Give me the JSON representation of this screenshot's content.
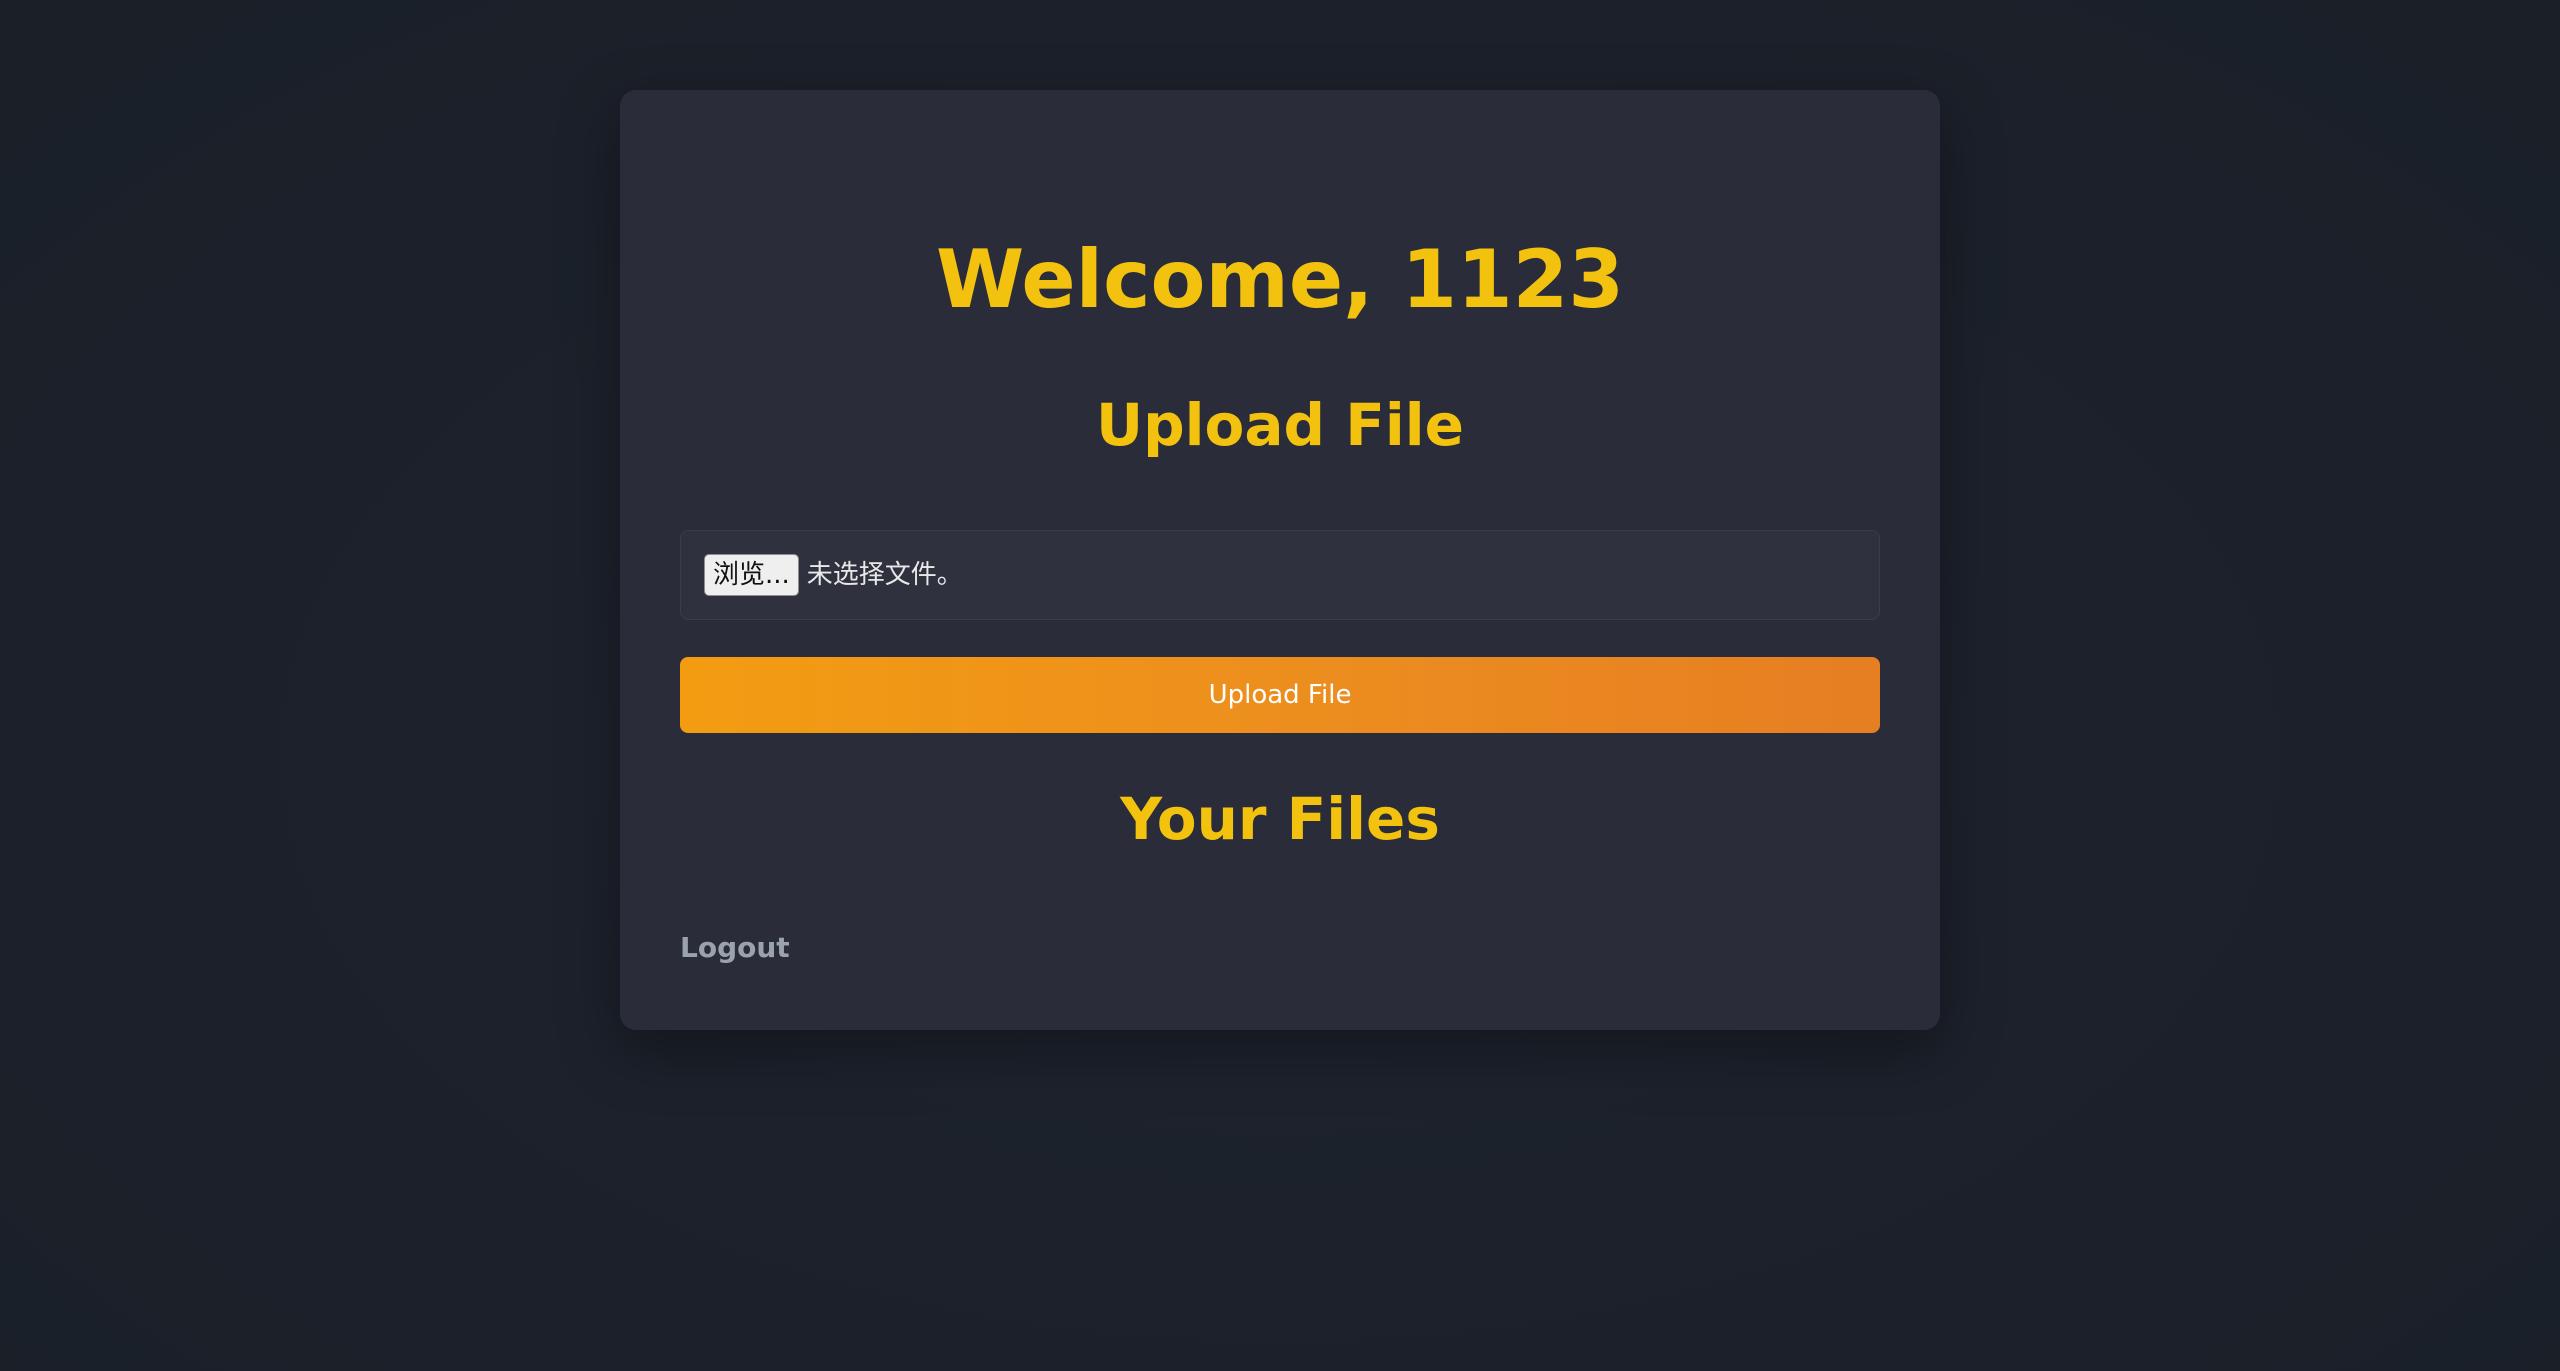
{
  "header": {
    "welcome_text": "Welcome, 1123"
  },
  "upload": {
    "title": "Upload File",
    "browse_label": "浏览...",
    "no_file_text": "未选择文件。",
    "button_label": "Upload File"
  },
  "files": {
    "title": "Your Files"
  },
  "logout": {
    "label": "Logout"
  },
  "colors": {
    "accent": "#f2c20f",
    "button_start": "#f39c12",
    "button_end": "#e67e22",
    "card": "#2a2d39",
    "background": "#1c212b"
  }
}
